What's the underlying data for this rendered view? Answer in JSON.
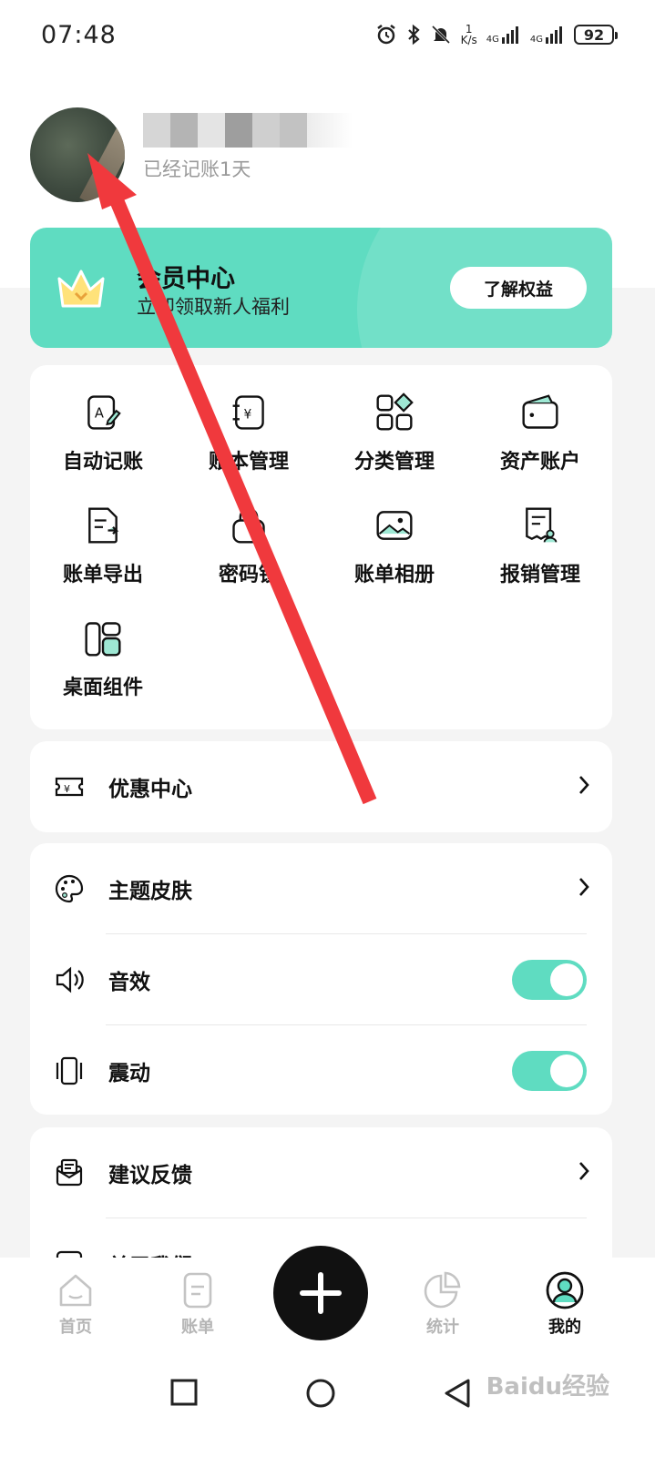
{
  "status_bar": {
    "time": "07:48",
    "net_speed_value": "1",
    "net_speed_unit": "K/s",
    "signal_1": "4G",
    "signal_2": "4G",
    "battery": "92"
  },
  "profile": {
    "subtitle": "已经记账1天"
  },
  "member": {
    "title": "会员中心",
    "subtitle": "立即领取新人福利",
    "button": "了解权益",
    "accent": "#5fdcc1"
  },
  "tools": [
    {
      "label": "自动记账",
      "icon": "auto-bookkeeping-icon"
    },
    {
      "label": "账本管理",
      "icon": "ledger-icon"
    },
    {
      "label": "分类管理",
      "icon": "category-icon"
    },
    {
      "label": "资产账户",
      "icon": "wallet-icon"
    },
    {
      "label": "账单导出",
      "icon": "export-icon"
    },
    {
      "label": "密码锁",
      "icon": "lock-icon"
    },
    {
      "label": "账单相册",
      "icon": "album-icon"
    },
    {
      "label": "报销管理",
      "icon": "reimburse-icon"
    },
    {
      "label": "桌面组件",
      "icon": "widget-icon"
    }
  ],
  "coupon": {
    "label": "优惠中心"
  },
  "settings": {
    "theme": "主题皮肤",
    "sound": "音效",
    "sound_on": true,
    "vibration": "震动",
    "vibration_on": true
  },
  "feedback": {
    "label": "建议反馈",
    "about": "关于我们"
  },
  "nav": {
    "home": "首页",
    "bills": "账单",
    "stats": "统计",
    "mine": "我的"
  },
  "watermark": "Baidu经验"
}
